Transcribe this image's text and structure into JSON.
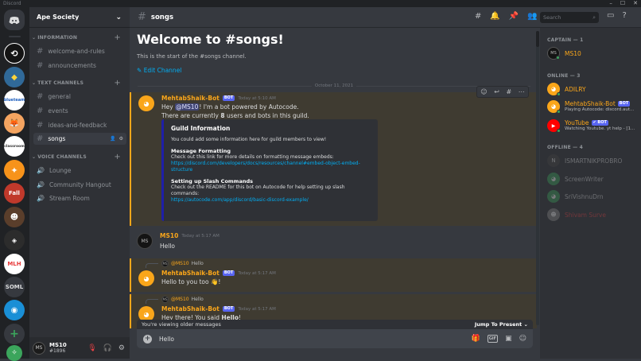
{
  "window": {
    "title": "Discord"
  },
  "server": {
    "name": "Ape Society"
  },
  "sidebar": {
    "categories": [
      {
        "label": "INFORMATION"
      },
      {
        "label": "TEXT CHANNELS"
      },
      {
        "label": "VOICE CHANNELS"
      }
    ],
    "channels": [
      {
        "label": "welcome-and-rules"
      },
      {
        "label": "announcements"
      },
      {
        "label": "general"
      },
      {
        "label": "events"
      },
      {
        "label": "ideas-and-feedback"
      },
      {
        "label": "songs"
      },
      {
        "label": "Lounge"
      },
      {
        "label": "Community Hangout"
      },
      {
        "label": "Stream Room"
      }
    ]
  },
  "guilds": {
    "items": [
      {
        "label": ""
      },
      {
        "label": ""
      },
      {
        "label": ""
      },
      {
        "label": "blueteam"
      },
      {
        "label": ""
      },
      {
        "label": "classroom"
      },
      {
        "label": ""
      },
      {
        "label": "Fall"
      },
      {
        "label": ""
      },
      {
        "label": ""
      },
      {
        "label": "MLH"
      },
      {
        "label": "SOML"
      },
      {
        "label": ""
      }
    ]
  },
  "user": {
    "name": "MS10",
    "tag": "#1896",
    "avatar": "MS"
  },
  "header": {
    "channel": "songs",
    "search_placeholder": "Search"
  },
  "welcome": {
    "title": "Welcome to #songs!",
    "subtitle": "This is the start of the #songs channel.",
    "edit_label": "Edit Channel"
  },
  "date_divider": "October 11, 2021",
  "messages": {
    "m1": {
      "author": "MehtabShaik-Bot",
      "bot": "BOT",
      "time": "Today at 5:10 AM",
      "l1_pre": "Hey ",
      "l1_mention": "@MS10",
      "l1_post": "! I'm a bot powered by Autocode.",
      "l2_pre": "There are currently ",
      "l2_num": "8",
      "l2_post": " users and bots in this guild.",
      "embed": {
        "title": "Guild Information",
        "desc": "You could add some information here for guild members to view!",
        "f1_name": "Message Formatting",
        "f1_text": "Check out this link for more details on formatting message embeds:",
        "f1_link1": "https://discord.com/developers/docs/resources/channel#embed-object-embed-",
        "f1_link2": "structure",
        "f2_name": "Setting up Slash Commands",
        "f2_text1": "Check out the README for this bot on Autocode for help setting up slash",
        "f2_text2": "commands:",
        "f2_link": "https://autocode.com/app/discord/basic-discord-example/"
      }
    },
    "m2": {
      "author": "MS10",
      "time": "Today at 5:17 AM",
      "text": "Hello"
    },
    "m3": {
      "reply_author": "@MS10",
      "reply_text": "Hello",
      "author": "MehtabShaik-Bot",
      "bot": "BOT",
      "time": "Today at 5:17 AM",
      "text": "Hello to you too",
      "emoji": "👋",
      "text_end": "!"
    },
    "m4": {
      "reply_author": "@MS10",
      "reply_text": "Hello",
      "author": "MehtabShaik-Bot",
      "bot": "BOT",
      "time": "Today at 5:17 AM",
      "text_pre": "Hey there! You said ",
      "text_bold": "Hello",
      "text_end": "!"
    }
  },
  "older_banner": {
    "text": "You're viewing older messages",
    "jump": "Jump To Present"
  },
  "composer": {
    "value": "Hello",
    "gif": "GIF"
  },
  "members": {
    "captain_header": "CAPTAIN — 1",
    "online_header": "ONLINE — 3",
    "offline_header": "OFFLINE — 4",
    "captain": [
      {
        "name": "MS10"
      }
    ],
    "online": [
      {
        "name": "ADILRY",
        "activity": ""
      },
      {
        "name": "MehtabShaik-Bot",
        "tag": "BOT",
        "activity": "Playing Autocode: discord.aut..."
      },
      {
        "name": "YouTube",
        "tag": "✔ BOT",
        "activity": "Watching Youtube. yt help - [1..."
      }
    ],
    "offline": [
      {
        "name": "ISMARTNIKPROBRO"
      },
      {
        "name": "ScreenWriter"
      },
      {
        "name": "SriVishnuDrn"
      },
      {
        "name": "Shivam Surve"
      }
    ]
  },
  "colors": {
    "accent": "#5865f2",
    "bot_orange": "#faa61a",
    "link": "#00aff4",
    "online": "#3ba55c"
  }
}
